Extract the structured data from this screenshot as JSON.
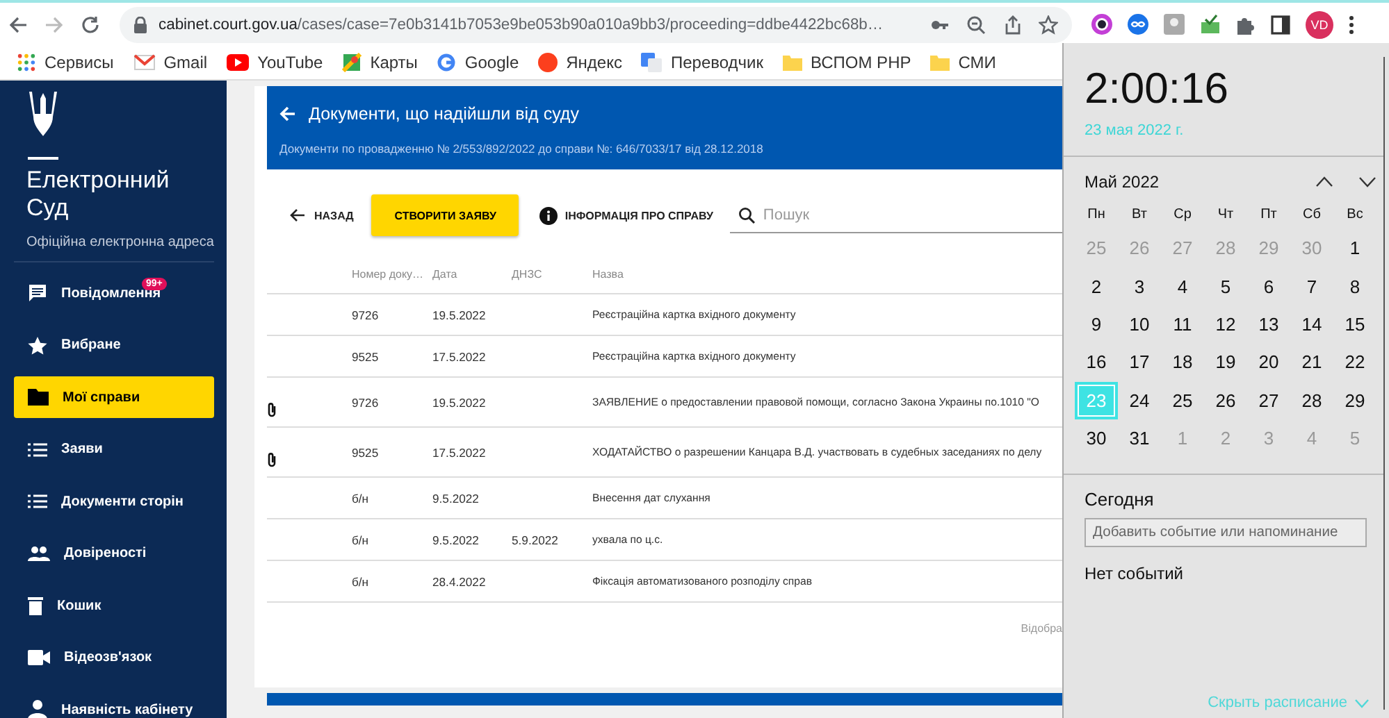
{
  "browser": {
    "url_host": "cabinet.court.gov.ua",
    "url_path": "/cases/case=7e0b3141b7053e9be053b90a010a9bb3/proceeding=ddbe4422bc68b…",
    "profile": "VD",
    "bookmarks": [
      {
        "label": "Сервисы"
      },
      {
        "label": "Gmail"
      },
      {
        "label": "YouTube"
      },
      {
        "label": "Карты"
      },
      {
        "label": "Google"
      },
      {
        "label": "Яндекс"
      },
      {
        "label": "Переводчик"
      },
      {
        "label": "ВСПОМ PHP"
      },
      {
        "label": "СМИ"
      }
    ]
  },
  "sidebar": {
    "title": "Електронний Суд",
    "subtitle": "Офіційна електронна адреса",
    "items": [
      {
        "label": "Повідомлення",
        "badge": "99+",
        "selected": false
      },
      {
        "label": "Вибране",
        "selected": false
      },
      {
        "label": "Мої справи",
        "selected": true
      },
      {
        "label": "Заяви",
        "selected": false
      },
      {
        "label": "Документи сторін",
        "selected": false
      },
      {
        "label": "Довіреності",
        "selected": false
      },
      {
        "label": "Кошик",
        "selected": false
      },
      {
        "label": "Відеозв'язок",
        "selected": false
      },
      {
        "label": "Наявність кабінету",
        "selected": false
      }
    ]
  },
  "page": {
    "title": "Документи, що надійшли від суду",
    "subtitle": "Документи по провадженню № 2/553/892/2022 до справи №: 646/7033/17 від 28.12.2018",
    "back": "НАЗАД",
    "create": "СТВОРИТИ ЗАЯВУ",
    "info": "ІНФОРМАЦІЯ ПРО СПРАВУ",
    "search_placeholder": "Пошук"
  },
  "table": {
    "columns": [
      "Номер доку…",
      "Дата",
      "ДНЗС",
      "Назва"
    ],
    "rows": [
      {
        "attachment": false,
        "number": "9726",
        "date": "19.5.2022",
        "name": "Реєстраційна картка вхідного документу"
      },
      {
        "attachment": false,
        "number": "9525",
        "date": "17.5.2022",
        "name": "Реєстраційна картка вхідного документу"
      },
      {
        "attachment": true,
        "number": "9726",
        "date": "19.5.2022",
        "name": "ЗАЯВЛЕНИЕ о предоставлении правовой помощи, согласно Закона Украины по.1010 \"О"
      },
      {
        "attachment": true,
        "number": "9525",
        "date": "17.5.2022",
        "name": "ХОДАТАЙСТВО о разрешении Канцара В.Д. участвовать в судебных заседаниях по делу"
      },
      {
        "attachment": false,
        "number": "б/н",
        "date": "9.5.2022",
        "name": "Внесення дат слухання"
      },
      {
        "attachment": false,
        "number": "б/н",
        "date": "9.5.2022",
        "dnzs": "5.9.2022",
        "name": "ухвала по ц.с."
      },
      {
        "attachment": false,
        "number": "б/н",
        "date": "28.4.2022",
        "name": "Фіксація автоматизованого розподілу справ"
      }
    ],
    "pagination_text": "Відобра"
  },
  "calendar": {
    "time": "2:00:16",
    "date": "23 мая 2022 г.",
    "month": "Май 2022",
    "weekdays": [
      "Пн",
      "Вт",
      "Ср",
      "Чт",
      "Пт",
      "Сб",
      "Вс"
    ],
    "days": [
      {
        "label": "25",
        "in_month": false,
        "selected": false
      },
      {
        "label": "26",
        "in_month": false,
        "selected": false
      },
      {
        "label": "27",
        "in_month": false,
        "selected": false
      },
      {
        "label": "28",
        "in_month": false,
        "selected": false
      },
      {
        "label": "29",
        "in_month": false,
        "selected": false
      },
      {
        "label": "30",
        "in_month": false,
        "selected": false
      },
      {
        "label": "1",
        "in_month": true,
        "selected": false
      },
      {
        "label": "2",
        "in_month": true,
        "selected": false
      },
      {
        "label": "3",
        "in_month": true,
        "selected": false
      },
      {
        "label": "4",
        "in_month": true,
        "selected": false
      },
      {
        "label": "5",
        "in_month": true,
        "selected": false
      },
      {
        "label": "6",
        "in_month": true,
        "selected": false
      },
      {
        "label": "7",
        "in_month": true,
        "selected": false
      },
      {
        "label": "8",
        "in_month": true,
        "selected": false
      },
      {
        "label": "9",
        "in_month": true,
        "selected": false
      },
      {
        "label": "10",
        "in_month": true,
        "selected": false
      },
      {
        "label": "11",
        "in_month": true,
        "selected": false
      },
      {
        "label": "12",
        "in_month": true,
        "selected": false
      },
      {
        "label": "13",
        "in_month": true,
        "selected": false
      },
      {
        "label": "14",
        "in_month": true,
        "selected": false
      },
      {
        "label": "15",
        "in_month": true,
        "selected": false
      },
      {
        "label": "16",
        "in_month": true,
        "selected": false
      },
      {
        "label": "17",
        "in_month": true,
        "selected": false
      },
      {
        "label": "18",
        "in_month": true,
        "selected": false
      },
      {
        "label": "19",
        "in_month": true,
        "selected": false
      },
      {
        "label": "20",
        "in_month": true,
        "selected": false
      },
      {
        "label": "21",
        "in_month": true,
        "selected": false
      },
      {
        "label": "22",
        "in_month": true,
        "selected": false
      },
      {
        "label": "23",
        "in_month": true,
        "selected": true
      },
      {
        "label": "24",
        "in_month": true,
        "selected": false
      },
      {
        "label": "25",
        "in_month": true,
        "selected": false
      },
      {
        "label": "26",
        "in_month": true,
        "selected": false
      },
      {
        "label": "27",
        "in_month": true,
        "selected": false
      },
      {
        "label": "28",
        "in_month": true,
        "selected": false
      },
      {
        "label": "29",
        "in_month": true,
        "selected": false
      },
      {
        "label": "30",
        "in_month": true,
        "selected": false
      },
      {
        "label": "31",
        "in_month": true,
        "selected": false
      },
      {
        "label": "1",
        "in_month": false,
        "selected": false
      },
      {
        "label": "2",
        "in_month": false,
        "selected": false
      },
      {
        "label": "3",
        "in_month": false,
        "selected": false
      },
      {
        "label": "4",
        "in_month": false,
        "selected": false
      },
      {
        "label": "5",
        "in_month": false,
        "selected": false
      }
    ],
    "today_label": "Сегодня",
    "add_event_placeholder": "Добавить событие или напоминание",
    "no_events": "Нет событий",
    "hide_schedule": "Скрыть расписание"
  }
}
